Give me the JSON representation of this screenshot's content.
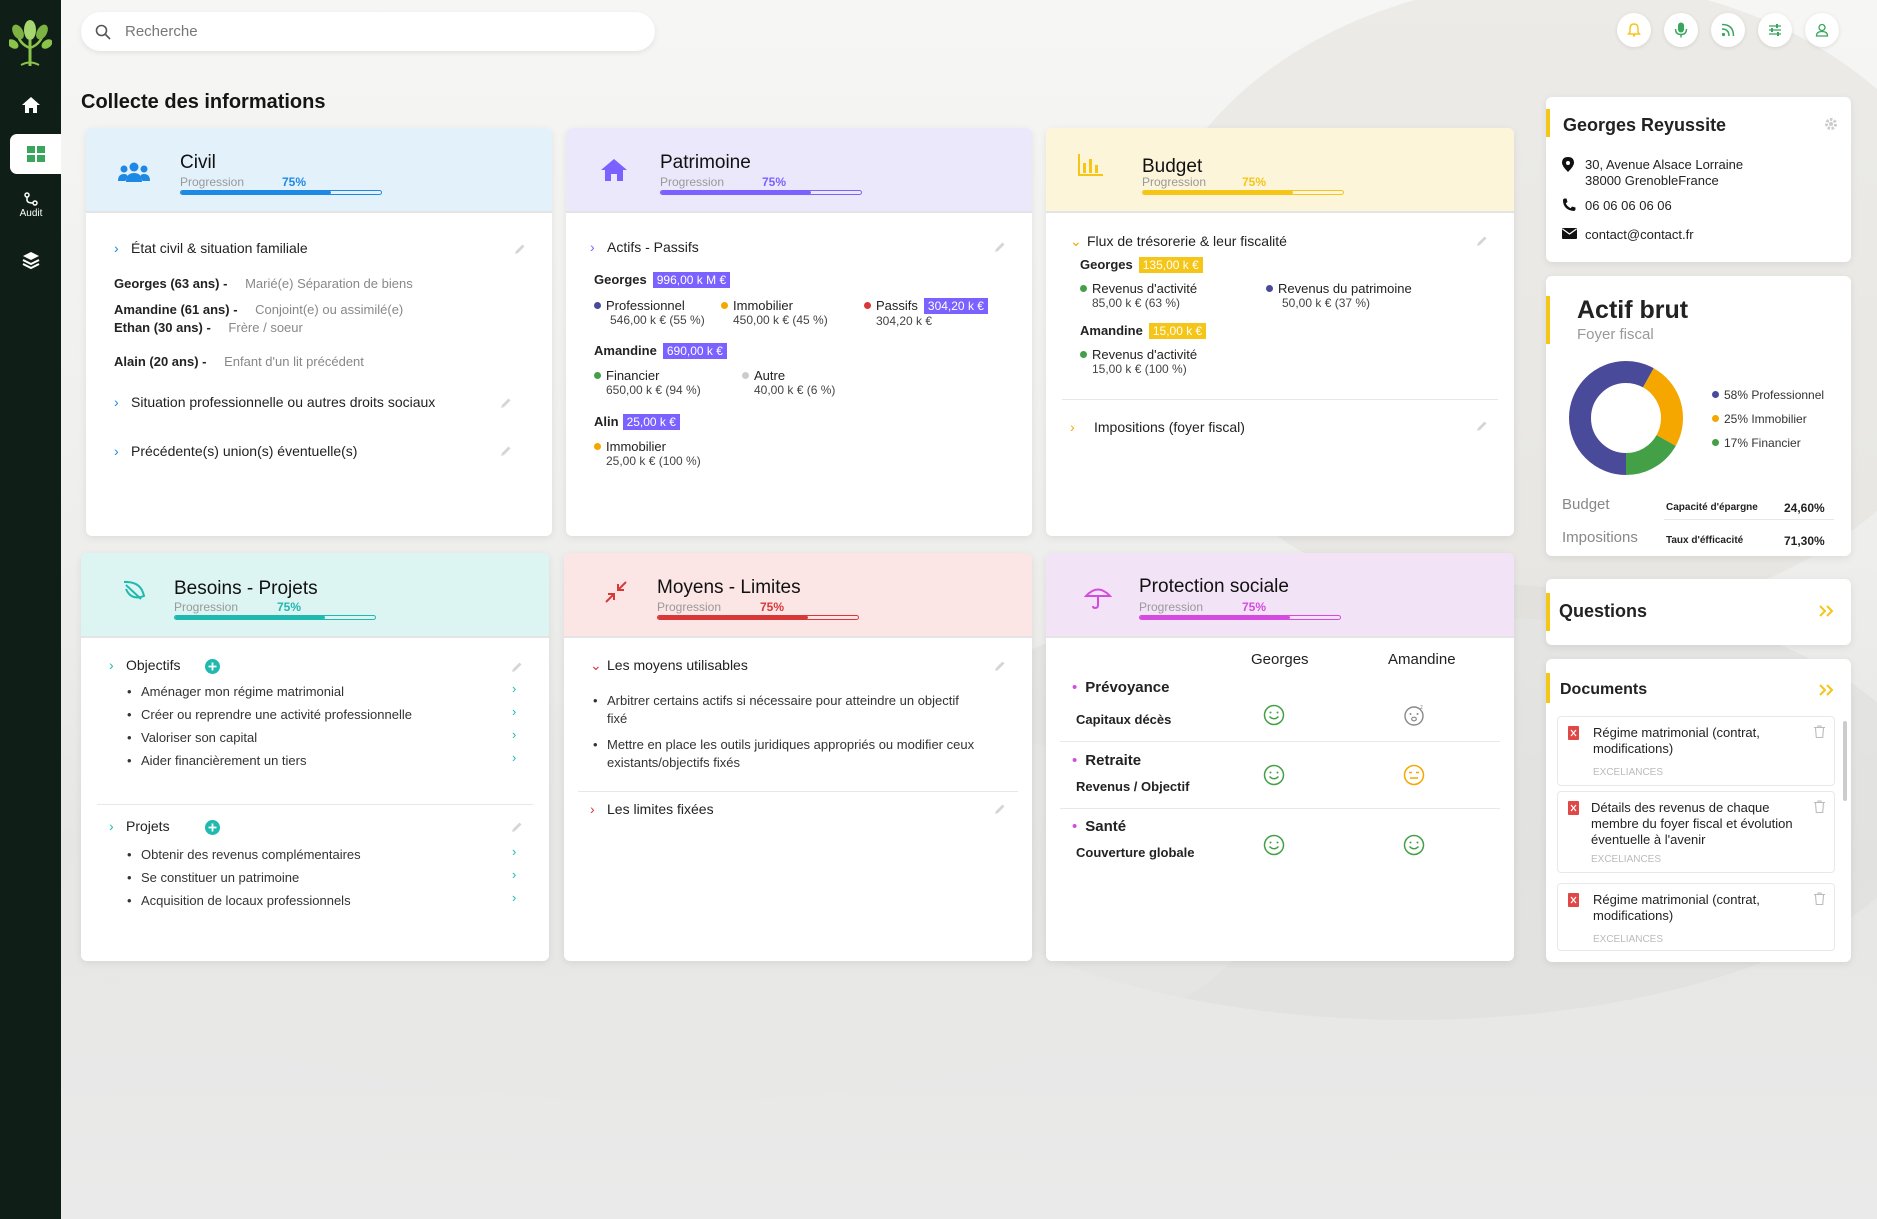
{
  "colors": {
    "sidebar": "#0f1f18",
    "civil": "#1e88e5",
    "patrimoine": "#7b61ff",
    "budget": "#f5c518",
    "besoins": "#1fb9b0",
    "moyens": "#d93838",
    "protection": "#d54be0",
    "green": "#43a047",
    "accent_yellow": "#f5c518"
  },
  "search": {
    "placeholder": "Recherche"
  },
  "sidebar": {
    "audit_label": "Audit"
  },
  "page_title": "Collecte des informations",
  "civil": {
    "title": "Civil",
    "progress_label": "Progression",
    "progress_pct": "75%",
    "progress": 0.75,
    "sections": [
      "État civil & situation familiale",
      "Situation professionnelle ou autres droits sociaux",
      "Précédente(s) union(s) éventuelle(s)"
    ],
    "people": [
      {
        "name": "Georges (63 ans) -",
        "info": "Marié(e) Séparation de biens"
      },
      {
        "name": "Amandine (61 ans) -",
        "info": "Conjoint(e) ou assimilé(e)"
      },
      {
        "name": "Ethan (30 ans) -",
        "info": "Frère / soeur"
      },
      {
        "name": "Alain (20 ans) -",
        "info": "Enfant d'un lit précédent"
      }
    ]
  },
  "patrimoine": {
    "title": "Patrimoine",
    "progress_label": "Progression",
    "progress_pct": "75%",
    "progress": 0.75,
    "section": "Actifs - Passifs",
    "georges": {
      "name": "Georges",
      "total": "996,00 k M €",
      "items": [
        {
          "label": "Professionnel",
          "value": "546,00 k € (55 %)",
          "color": "#4a4a9a"
        },
        {
          "label": "Immobilier",
          "value": "450,00 k € (45 %)",
          "color": "#f5a700"
        },
        {
          "label": "Passifs",
          "value": "304,20 k €",
          "color": "#d93838",
          "badge": "304,20 k €"
        }
      ]
    },
    "amandine": {
      "name": "Amandine",
      "total": "690,00 k €",
      "items": [
        {
          "label": "Financier",
          "value": "650,00 k € (94 %)",
          "color": "#43a047"
        },
        {
          "label": "Autre",
          "value": "40,00 k € (6 %)",
          "color": "#cccccc"
        }
      ]
    },
    "alin": {
      "name": "Alin",
      "total": "25,00 k €",
      "items": [
        {
          "label": "Immobilier",
          "value": "25,00 k € (100 %)",
          "color": "#f5a700"
        }
      ]
    }
  },
  "budget": {
    "title": "Budget",
    "progress_label": "Progression",
    "progress_pct": "75%",
    "progress": 0.75,
    "section1": "Flux de trésorerie & leur fiscalité",
    "section2": "Impositions (foyer fiscal)",
    "georges": {
      "name": "Georges",
      "total": "135,00 k €",
      "items": [
        {
          "label": "Revenus d'activité",
          "value": "85,00 k € (63 %)",
          "color": "#43a047"
        },
        {
          "label": "Revenus du patrimoine",
          "value": "50,00 k € (37 %)",
          "color": "#4a4a9a"
        }
      ]
    },
    "amandine": {
      "name": "Amandine",
      "total": "15,00 k €",
      "items": [
        {
          "label": "Revenus d'activité",
          "value": "15,00 k € (100 %)",
          "color": "#43a047"
        }
      ]
    }
  },
  "besoins": {
    "title": "Besoins - Projets",
    "progress_label": "Progression",
    "progress_pct": "75%",
    "progress": 0.75,
    "objectifs_label": "Objectifs",
    "projets_label": "Projets",
    "objectifs": [
      "Aménager mon régime matrimonial",
      "Créer ou reprendre une activité professionnelle",
      "Valoriser son capital",
      "Aider financièrement un tiers"
    ],
    "projets": [
      "Obtenir des revenus complémentaires",
      "Se constituer un patrimoine",
      "Acquisition de locaux professionnels"
    ]
  },
  "moyens": {
    "title": "Moyens - Limites",
    "progress_label": "Progression",
    "progress_pct": "75%",
    "progress": 0.75,
    "section1": "Les moyens utilisables",
    "section2": "Les limites fixées",
    "items": [
      "Arbitrer certains actifs si nécessaire pour atteindre un objectif fixé",
      "Mettre en place les outils juridiques appropriés ou modifier ceux existants/objectifs fixés"
    ]
  },
  "protection": {
    "title": "Protection sociale",
    "progress_label": "Progression",
    "progress_pct": "75%",
    "progress": 0.75,
    "col1": "Georges",
    "col2": "Amandine",
    "rows": [
      {
        "label": "Prévoyance",
        "sub": "Capitaux décès",
        "georges": "satisfied",
        "amandine": "pending"
      },
      {
        "label": "Retraite",
        "sub": "Revenus / Objectif",
        "georges": "satisfied",
        "amandine": "neutral"
      },
      {
        "label": "Santé",
        "sub": "Couverture globale",
        "georges": "satisfied",
        "amandine": "satisfied"
      }
    ]
  },
  "client": {
    "name": "Georges Reyussite",
    "address1": "30, Avenue Alsace Lorraine",
    "address2": "38000 GrenobleFrance",
    "phone": "06 06 06 06 06",
    "email": "contact@contact.fr"
  },
  "actif": {
    "title": "Actif brut",
    "subtitle": "Foyer fiscal",
    "legend": [
      {
        "label": "58% Professionnel",
        "color": "#4a4a9a"
      },
      {
        "label": "25% Immobilier",
        "color": "#f5a700"
      },
      {
        "label": "17% Financier",
        "color": "#43a047"
      }
    ],
    "budget_label": "Budget",
    "budget_metric": "Capacité d'épargne",
    "budget_value": "24,60%",
    "impositions_label": "Impositions",
    "impositions_metric": "Taux d'éfficacité",
    "impositions_value": "71,30%"
  },
  "chart_data": {
    "type": "pie",
    "categories": [
      "Professionnel",
      "Immobilier",
      "Financier"
    ],
    "values": [
      58,
      25,
      17
    ]
  },
  "questions": {
    "title": "Questions"
  },
  "documents": {
    "title": "Documents",
    "items": [
      {
        "title": "Régime matrimonial (contrat, modifications)",
        "source": "EXCELIANCES"
      },
      {
        "title": "Détails des revenus de chaque membre du foyer fiscal et évolution éventuelle à l'avenir",
        "source": "EXCELIANCES"
      },
      {
        "title": "Régime matrimonial (contrat, modifications)",
        "source": "EXCELIANCES"
      }
    ]
  }
}
